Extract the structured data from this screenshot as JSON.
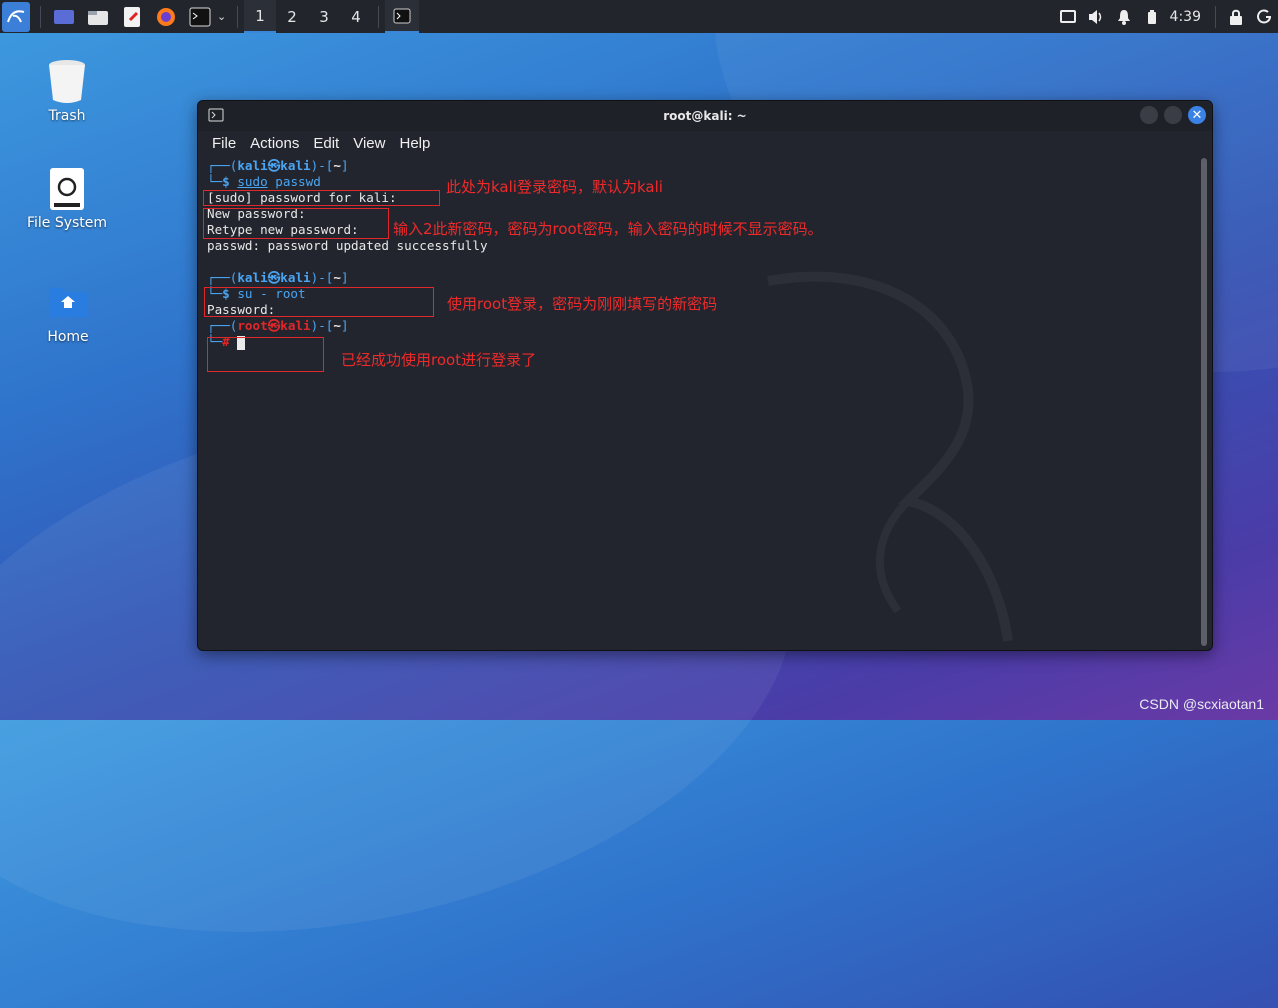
{
  "taskbar": {
    "workspaces": [
      "1",
      "2",
      "3",
      "4"
    ],
    "clock": "4:39"
  },
  "desktop": {
    "icons": [
      {
        "label": "Trash"
      },
      {
        "label": "File System"
      },
      {
        "label": "Home"
      }
    ]
  },
  "window": {
    "title": "root@kali: ~",
    "menu": [
      "File",
      "Actions",
      "Edit",
      "View",
      "Help"
    ]
  },
  "terminal": {
    "prompt1": {
      "user": "kali",
      "symbol": "㉿",
      "host": "kali",
      "dir": "~",
      "command_cmd": "sudo",
      "command_arg": "passwd"
    },
    "sudo_prompt": "[sudo] password for kali:",
    "new_password": "New password:",
    "retype_password": "Retype new password:",
    "updated": "passwd: password updated successfully",
    "prompt2": {
      "user": "kali",
      "symbol": "㉿",
      "host": "kali",
      "dir": "~",
      "command": "su - root"
    },
    "password": "Password:",
    "prompt3": {
      "user": "root",
      "symbol": "㉿",
      "host": "kali",
      "dir": "~"
    }
  },
  "annotations": {
    "note1": "此处为kali登录密码，默认为kali",
    "note2": "输入2此新密码，密码为root密码，输入密码的时候不显示密码。",
    "note3": "使用root登录，密码为刚刚填写的新密码",
    "note4": "已经成功使用root进行登录了"
  },
  "watermark": "CSDN @scxiaotan1",
  "colors": {
    "accent": "#3a86d9",
    "prompt_blue": "#4aa5f2",
    "root_red": "#e0272a",
    "annotation_red": "#ef2a2a"
  }
}
